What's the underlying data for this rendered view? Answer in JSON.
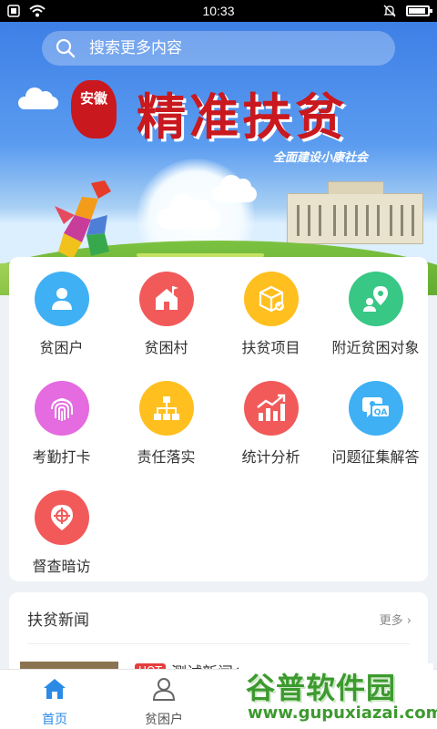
{
  "status_bar": {
    "time": "10:33"
  },
  "banner": {
    "search_placeholder": "搜索更多内容",
    "seal_text": "安徽",
    "headline": "精准扶贫",
    "subline": "全面建设小康社会"
  },
  "menu": {
    "items": [
      {
        "label": "贫困户",
        "icon": "person-icon",
        "color": "#3fb0f4"
      },
      {
        "label": "贫困村",
        "icon": "house-flag-icon",
        "color": "#f25a5a"
      },
      {
        "label": "扶贫项目",
        "icon": "box-icon",
        "color": "#ffbf1f"
      },
      {
        "label": "附近贫困对象",
        "icon": "location-person-icon",
        "color": "#39c786"
      },
      {
        "label": "考勤打卡",
        "icon": "fingerprint-icon",
        "color": "#e46be0"
      },
      {
        "label": "责任落实",
        "icon": "org-chart-icon",
        "color": "#ffbf1f"
      },
      {
        "label": "统计分析",
        "icon": "trend-chart-icon",
        "color": "#f25a5a"
      },
      {
        "label": "问题征集解答",
        "icon": "qa-icon",
        "color": "#3fb0f4"
      },
      {
        "label": "督查暗访",
        "icon": "target-pin-icon",
        "color": "#f25a5a"
      }
    ]
  },
  "news": {
    "title": "扶贫新闻",
    "more": "更多 ›",
    "hot_badge": "HOT",
    "first_item_title": "测试新闻全部志"
  },
  "tabbar": {
    "items": [
      {
        "label": "首页",
        "icon": "home-icon",
        "active": true
      },
      {
        "label": "贫困户",
        "icon": "user-icon",
        "active": false
      }
    ],
    "active_color": "#2b8ae6",
    "inactive_color": "#555555"
  },
  "watermark": {
    "line1": "谷普软件园",
    "line2": "www.gupuxiazai.com"
  }
}
